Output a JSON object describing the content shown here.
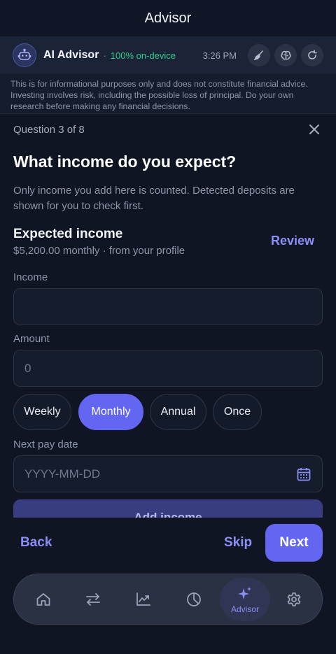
{
  "header": {
    "title": "Advisor"
  },
  "advisor": {
    "name": "AI Advisor",
    "separator": "·",
    "status": "100% on-device",
    "time": "3:26 PM",
    "icons": [
      "robot-icon",
      "broom-icon",
      "brain-icon",
      "refresh-icon"
    ]
  },
  "disclaimer": "This is for informational purposes only and does not constitute financial advice. Investing involves risk, including the possible loss of principal. Do your own research before making any financial decisions.",
  "question": {
    "counter": "Question 3 of 8",
    "title": "What income do you expect?",
    "description": "Only income you add here is counted. Detected deposits are shown for you to check first."
  },
  "expected": {
    "title": "Expected income",
    "subtitle": "$5,200.00 monthly · from your profile",
    "review_label": "Review"
  },
  "form": {
    "income_label": "Income",
    "income_value": "",
    "amount_label": "Amount",
    "amount_placeholder": "0",
    "frequency_options": [
      "Weekly",
      "Monthly",
      "Annual",
      "Once"
    ],
    "frequency_selected": "Monthly",
    "date_label": "Next pay date",
    "date_placeholder": "YYYY-MM-DD",
    "add_label": "Add income"
  },
  "footer": {
    "back_label": "Back",
    "skip_label": "Skip",
    "next_label": "Next"
  },
  "tabbar": {
    "tabs": [
      {
        "icon": "home-icon",
        "label": ""
      },
      {
        "icon": "transfer-arrows-icon",
        "label": ""
      },
      {
        "icon": "trend-chart-icon",
        "label": ""
      },
      {
        "icon": "pie-chart-icon",
        "label": ""
      },
      {
        "icon": "sparkles-icon",
        "label": "Advisor"
      },
      {
        "icon": "gear-icon",
        "label": ""
      }
    ],
    "active_index": 4
  },
  "colors": {
    "accent": "#6366f1",
    "accent_text": "#8b8ef5",
    "status_green": "#2fcf8a",
    "background": "#0f1523"
  }
}
